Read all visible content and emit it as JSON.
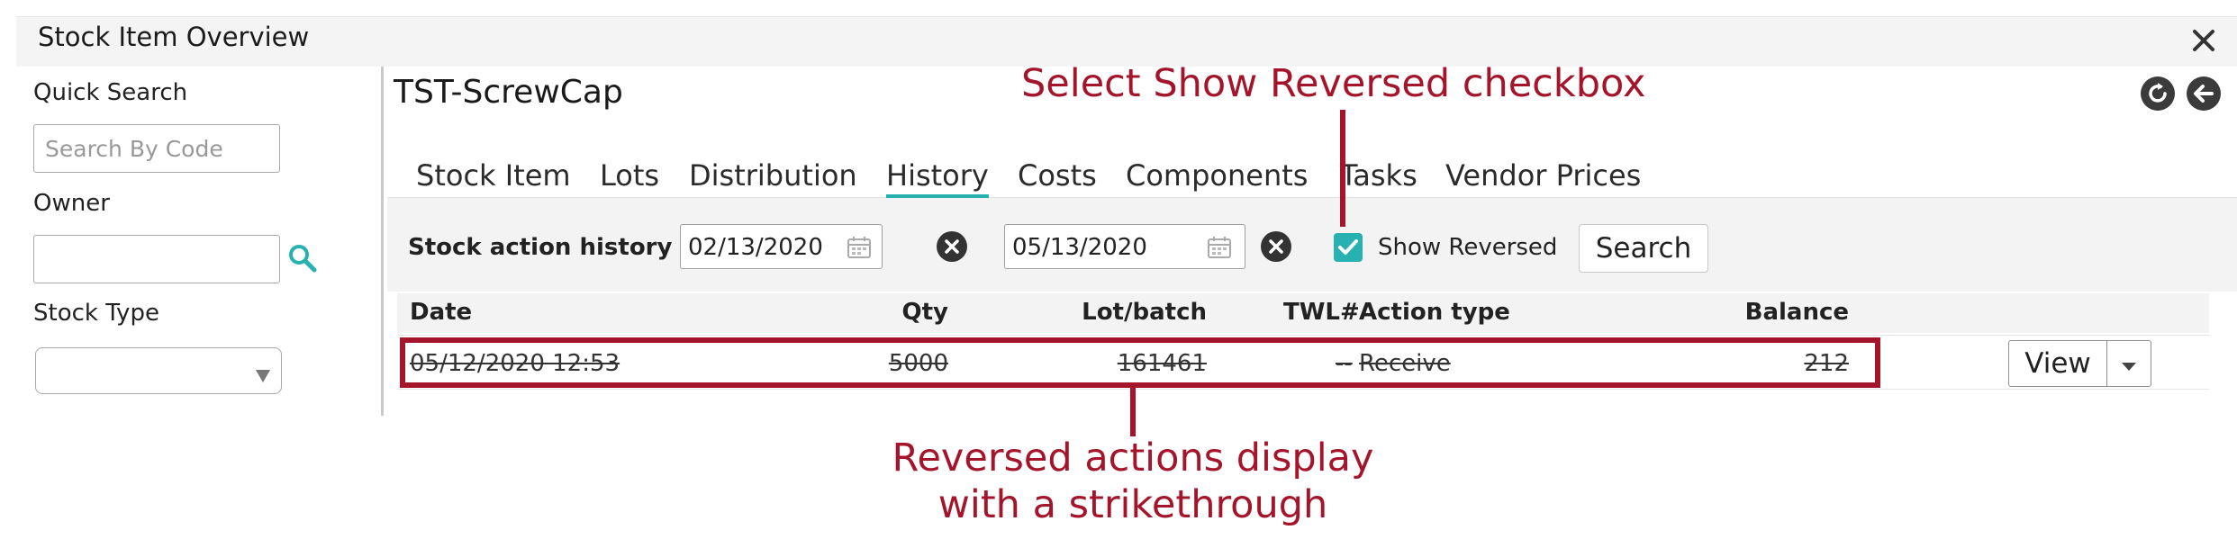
{
  "window": {
    "title": "Stock Item Overview"
  },
  "sidebar": {
    "quick_search_label": "Quick Search",
    "search_placeholder": "Search By Code",
    "owner_label": "Owner",
    "owner_value": "",
    "stock_type_label": "Stock Type",
    "stock_type_value": ""
  },
  "item": {
    "code": "TST-ScrewCap"
  },
  "tabs": [
    {
      "label": "Stock Item"
    },
    {
      "label": "Lots"
    },
    {
      "label": "Distribution"
    },
    {
      "label": "History",
      "active": true
    },
    {
      "label": "Costs"
    },
    {
      "label": "Components"
    },
    {
      "label": "Tasks"
    },
    {
      "label": "Vendor Prices"
    }
  ],
  "filters": {
    "label": "Stock action history",
    "from_date": "02/13/2020",
    "to_date": "05/13/2020",
    "show_reversed_label": "Show Reversed",
    "show_reversed_checked": true,
    "search_label": "Search"
  },
  "table": {
    "columns": {
      "date": "Date",
      "qty": "Qty",
      "lot": "Lot/batch",
      "twl": "TWL#",
      "action_type": "Action type",
      "balance": "Balance"
    },
    "rows": [
      {
        "date": "05/12/2020 12:53",
        "qty": "5000",
        "lot": "161461",
        "twl": "--",
        "action_type": "Receive",
        "balance": "212",
        "reversed": true,
        "view_label": "View"
      }
    ]
  },
  "annotations": {
    "top": "Select Show Reversed checkbox",
    "bottom_line1": "Reversed actions display",
    "bottom_line2": "with a strikethrough"
  },
  "colors": {
    "accent": "#27b1b0",
    "annotation": "#a4152b"
  },
  "icons": [
    "close-icon",
    "search-icon",
    "refresh-icon",
    "back-arrow-icon",
    "calendar-icon",
    "clear-icon",
    "check-icon",
    "caret-down-icon",
    "dropdown-arrow-icon"
  ]
}
